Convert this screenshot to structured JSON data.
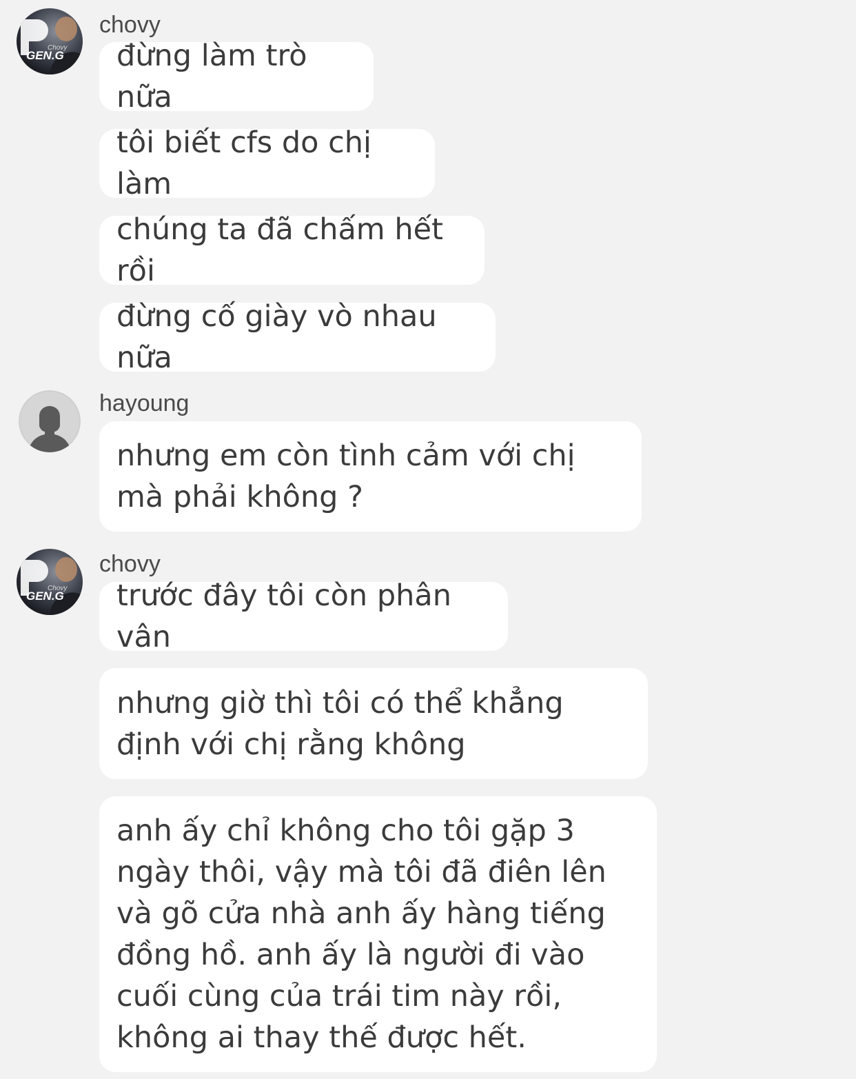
{
  "groups": [
    {
      "sender": "chovy",
      "avatar": {
        "icon": "chovy-geng-avatar-icon",
        "logo_text": "GEN.G",
        "sub_text": "Chovy"
      },
      "messages": [
        "đừng làm trò nữa",
        "tôi biết cfs do chị làm",
        "chúng ta đã chấm hết rồi",
        "đừng cố giày vò nhau nữa"
      ]
    },
    {
      "sender": "hayoung",
      "avatar": {
        "icon": "default-person-avatar-icon"
      },
      "messages": [
        "nhưng em còn tình cảm với chị mà phải không ?"
      ]
    },
    {
      "sender": "chovy",
      "avatar": {
        "icon": "chovy-geng-avatar-icon",
        "logo_text": "GEN.G",
        "sub_text": "Chovy"
      },
      "messages": [
        "trước đây tôi còn phân vân",
        "nhưng giờ thì tôi có thể khẳng định với chị rằng không",
        "anh ấy chỉ không cho tôi gặp 3 ngày thôi, vậy mà tôi đã điên lên và gõ cửa nhà anh ấy hàng tiếng đồng hồ. anh ấy là người đi vào cuối cùng của trái tim này rồi, không ai thay thế được hết."
      ]
    }
  ],
  "colors": {
    "background": "#f2f2f2",
    "bubble": "#ffffff",
    "text": "#3b3b3b"
  }
}
